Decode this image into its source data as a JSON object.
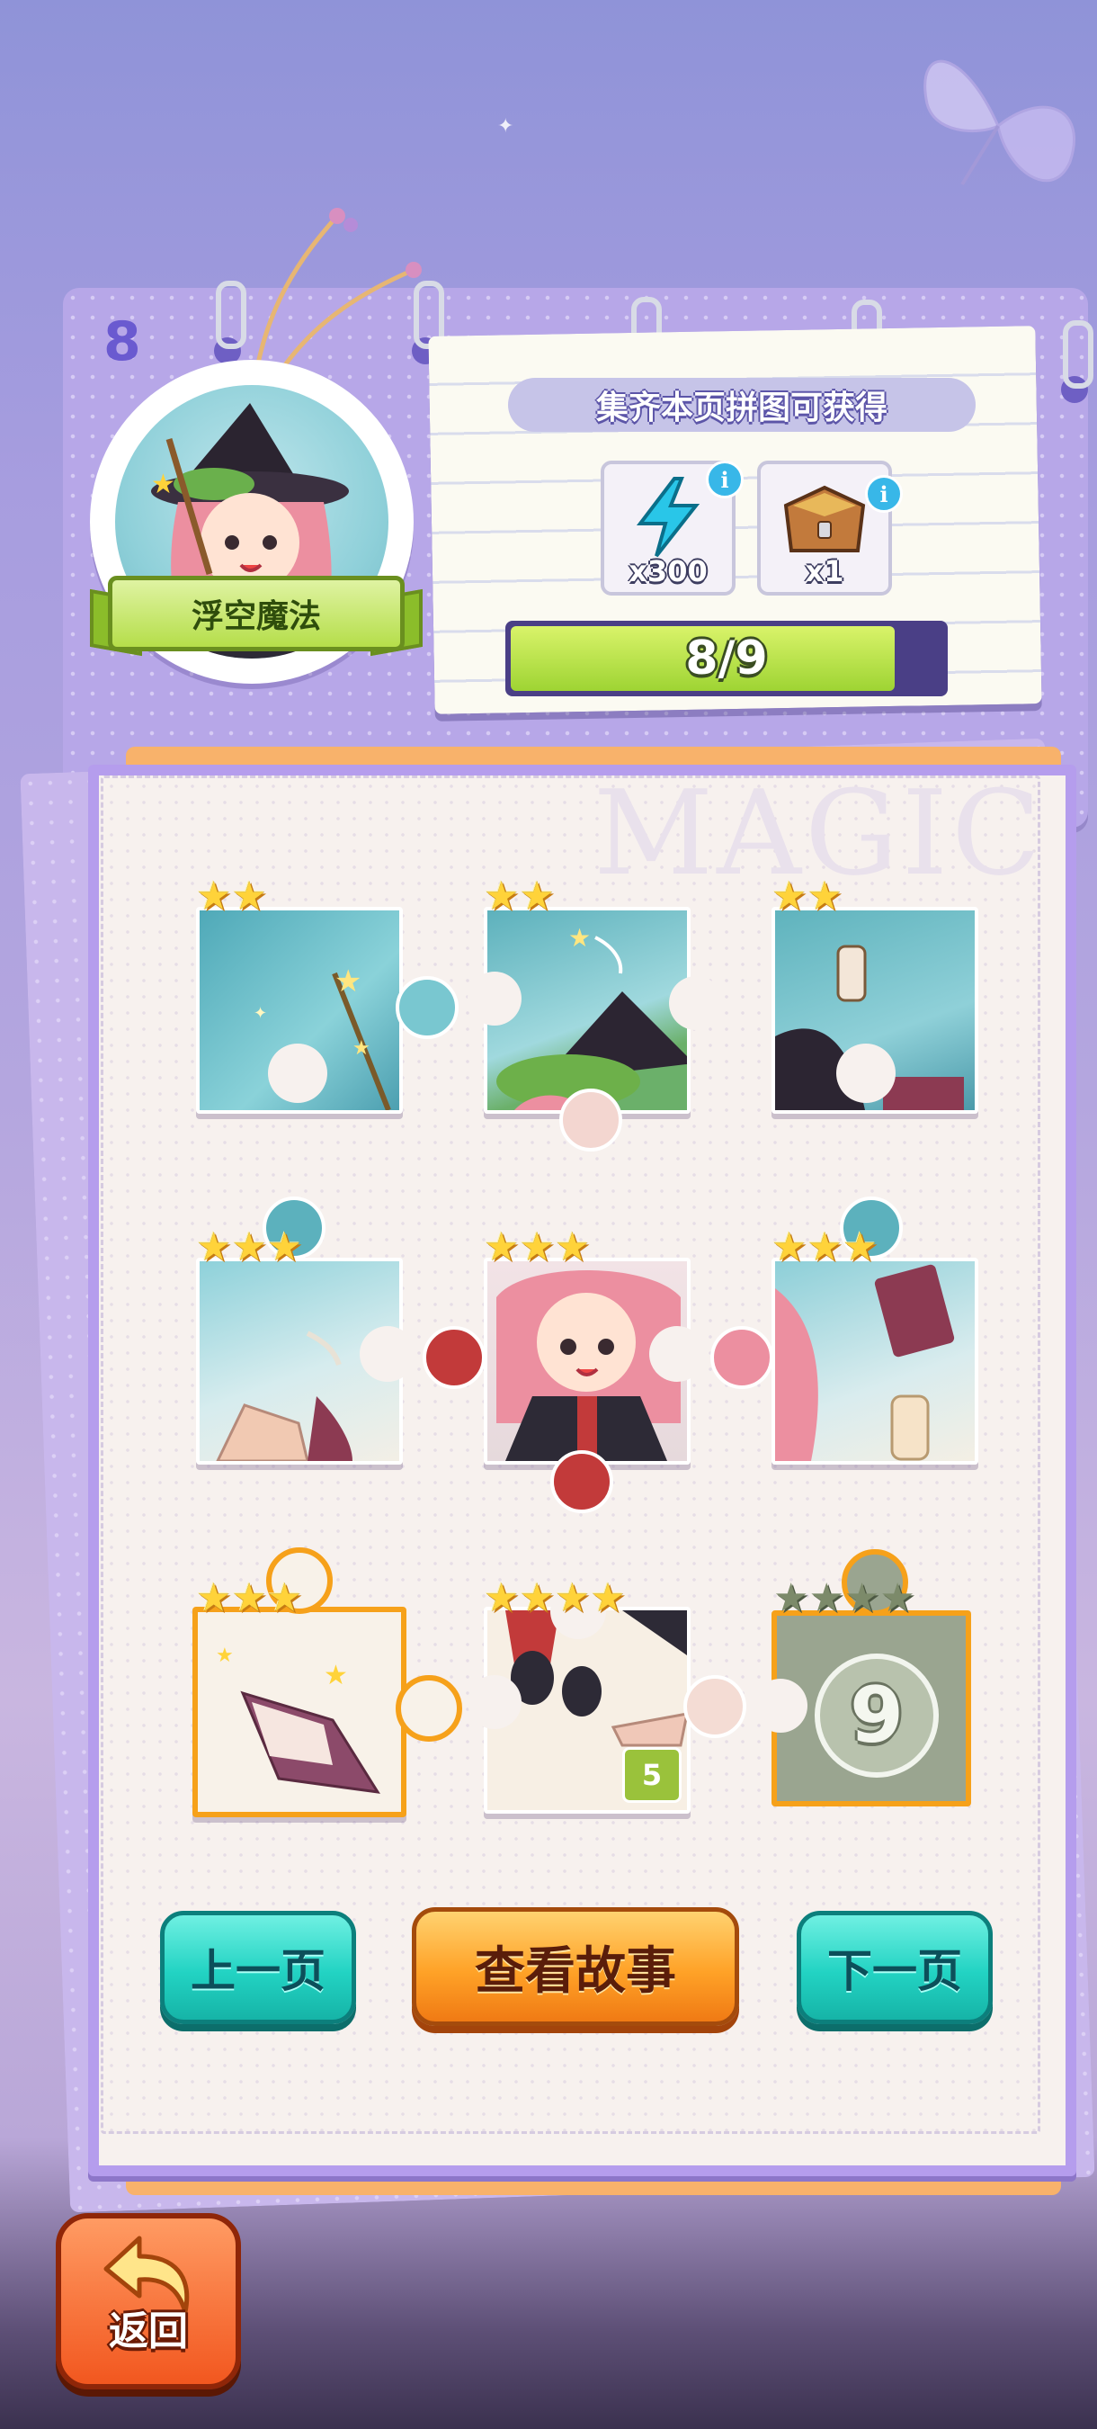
{
  "chapter": {
    "page_number": "8",
    "title": "浮空魔法"
  },
  "reward": {
    "title": "集齐本页拼图可获得",
    "items": [
      {
        "icon": "energy-bolt-icon",
        "quantity": "x300"
      },
      {
        "icon": "treasure-chest-icon",
        "quantity": "x1"
      }
    ],
    "progress_text": "8/9",
    "progress_fraction": 0.889
  },
  "board": {
    "watermark": "MAGIC",
    "pieces": [
      {
        "row": 1,
        "col": 1,
        "stars": 2,
        "max_stars": 2,
        "state": "collected"
      },
      {
        "row": 1,
        "col": 2,
        "stars": 2,
        "max_stars": 2,
        "state": "collected"
      },
      {
        "row": 1,
        "col": 3,
        "stars": 2,
        "max_stars": 2,
        "state": "collected"
      },
      {
        "row": 2,
        "col": 1,
        "stars": 3,
        "max_stars": 3,
        "state": "collected"
      },
      {
        "row": 2,
        "col": 2,
        "stars": 3,
        "max_stars": 3,
        "state": "collected"
      },
      {
        "row": 2,
        "col": 3,
        "stars": 3,
        "max_stars": 3,
        "state": "collected"
      },
      {
        "row": 3,
        "col": 1,
        "stars": 3,
        "max_stars": 3,
        "state": "highlighted"
      },
      {
        "row": 3,
        "col": 2,
        "stars": 4,
        "max_stars": 4,
        "state": "collected",
        "count": "5"
      },
      {
        "row": 3,
        "col": 3,
        "stars": 0,
        "max_stars": 4,
        "state": "locked",
        "number": "9"
      }
    ]
  },
  "buttons": {
    "prev": "上一页",
    "story": "查看故事",
    "next": "下一页",
    "back": "返回"
  },
  "colors": {
    "accent_teal": "#22d3c3",
    "accent_orange": "#ffa227",
    "progress_green": "#9ed433",
    "board_border": "#b59ded"
  }
}
